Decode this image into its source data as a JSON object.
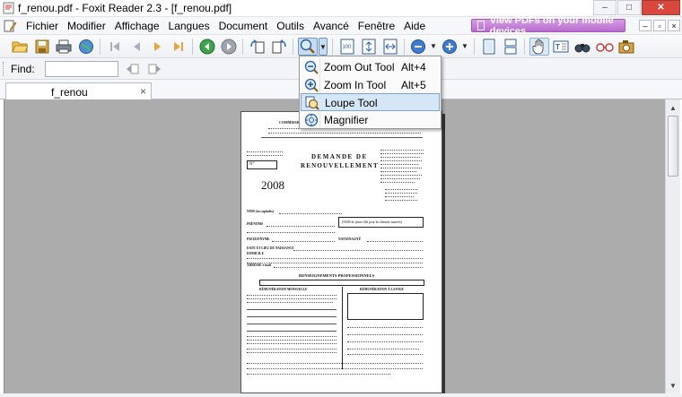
{
  "window": {
    "title": "f_renou.pdf - Foxit Reader 2.3 - [f_renou.pdf]",
    "minimize_label": "–",
    "maximize_label": "□",
    "close_label": "✕"
  },
  "menubar": {
    "items": [
      "Fichier",
      "Modifier",
      "Affichage",
      "Langues",
      "Document",
      "Outils",
      "Avancé",
      "Fenêtre",
      "Aide"
    ],
    "promo_label": "View PDFs on your mobile devices"
  },
  "find": {
    "label": "Find:",
    "value": ""
  },
  "tabs": [
    {
      "label": "f_renou",
      "close": "×"
    }
  ],
  "zoom_menu": {
    "items": [
      {
        "label": "Zoom Out Tool",
        "shortcut": "Alt+4",
        "icon": "zoom-out-icon"
      },
      {
        "label": "Zoom In Tool",
        "shortcut": "Alt+5",
        "icon": "zoom-in-icon"
      },
      {
        "label": "Loupe Tool",
        "shortcut": "",
        "icon": "loupe-icon",
        "highlighted": true
      },
      {
        "label": "Magnifier",
        "shortcut": "",
        "icon": "magnifier-icon"
      }
    ]
  },
  "document": {
    "header_org": "COMMISSION DE LA C...",
    "title_line1": "DEMANDE DE",
    "title_line2": "RENOUVELLEMENT",
    "year": "2008",
    "number_label": "N°",
    "field_nom": "NOM (en capitales)",
    "field_prenoms": "PRÉNOMS",
    "field_pseudonyme": "PSEUDONYME",
    "field_nationalite": "NATIONALITÉ",
    "field_date_lieu": "DATE ET LIEU DE NAISSANCE",
    "field_domicile": "DOMICILE",
    "field_adresse": "ADRESSE e-mail",
    "field_nom_jeune_fille": "(NOM de jeune fille pour les femmes mariées)",
    "section_title": "RENSEIGNEMENTS PROFESSIONNELS",
    "col_left_title": "RÉMUNÉRATION MENSUELLE",
    "col_right_title": "RÉMUNÉRATION À LA PIGE"
  },
  "colors": {
    "viewer_bg": "#acacac",
    "promo_bg": "#c27fd6",
    "highlight": "#d5e6f7"
  }
}
